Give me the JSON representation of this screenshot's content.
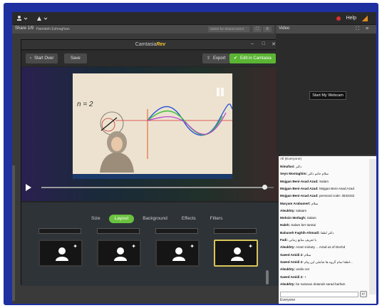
{
  "topbar": {
    "help_label": "Help"
  },
  "share_panel": {
    "title": "Share 1/9",
    "presenter": "Hamideh Eshraghian",
    "select_placeholder": "Select for ShareControl"
  },
  "video_panel": {
    "title": "Video",
    "webcam_button": "Start My Webcam"
  },
  "camtasia": {
    "title_prefix": "Camtasia",
    "title_suffix": "Rev",
    "start_over_label": "Start Over",
    "save_label": "Save",
    "export_label": "Export",
    "edit_label": "Edit in Camtasia",
    "slide_label": "n = 2",
    "playback_progress": 0.96,
    "tabs": [
      {
        "label": "Size",
        "active": false
      },
      {
        "label": "Layout",
        "active": true
      },
      {
        "label": "Background",
        "active": false
      },
      {
        "label": "Effects",
        "active": false
      },
      {
        "label": "Filters",
        "active": false
      }
    ],
    "selected_tile_index": 3
  },
  "chat": {
    "header": "All (Everyone)",
    "messages": [
      {
        "sender": "Nimafasi:",
        "text": "دکتر"
      },
      {
        "sender": "Seyn Mostaghim:",
        "text": "سلام خانم دکتر"
      },
      {
        "sender": "Mojgan Beni-Asad Azad:",
        "text": "Salam"
      },
      {
        "sender": "Mojgan Beni-Asad Azad:",
        "text": "Mojgan Beni-Asad Azad"
      },
      {
        "sender": "Mojgan Beni-Asad Azad:",
        "text": "personal code: 3633432"
      },
      {
        "sender": "Maryam Arabamerl:",
        "text": "سلام"
      },
      {
        "sender": "Aleukhty:",
        "text": "salaam"
      },
      {
        "sender": "Mohsin Motlagh:",
        "text": "Salam"
      },
      {
        "sender": "Haleh:",
        "text": "Salam ber tamtai"
      },
      {
        "sender": "Bahaneh Faghih-Ahmadi:",
        "text": "دکتر لطفا"
      },
      {
        "sender": "Fadi:",
        "text": "با تعریف منابع زمانی"
      },
      {
        "sender": "Aleukhty:",
        "text": "Azam Irukuty ... Azad us of Dechd"
      },
      {
        "sender": "Saeed Amidi 2:",
        "text": "سلام"
      },
      {
        "sender": "Saeed Amidi 2:",
        "text": "لطفا تمام گروه ها شاملی این پیام..."
      },
      {
        "sender": "Aleukhty:",
        "text": "vedio not"
      },
      {
        "sender": "Saeed Amidi 2:",
        "text": "+"
      },
      {
        "sender": "Aleukhty:",
        "text": "be razanan dotanah sarad barfam"
      }
    ],
    "footer": "Everyone"
  },
  "colors": {
    "frame": "#1e2fa0",
    "accent_green": "#5bb534",
    "selected_tile_border": "#d8c55a",
    "record": "#d83030"
  }
}
